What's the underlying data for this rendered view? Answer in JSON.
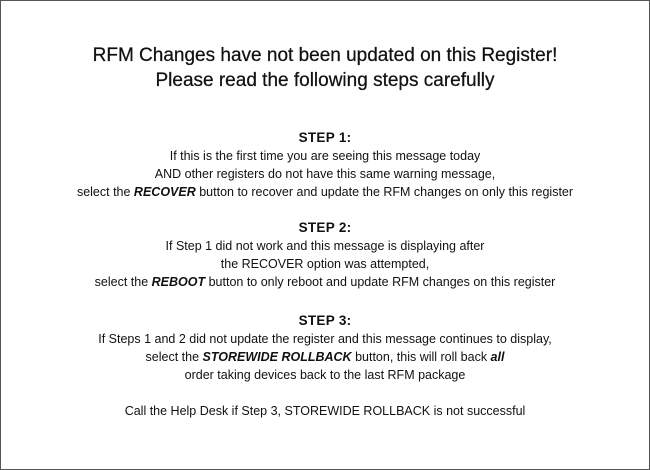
{
  "header": {
    "line1": "RFM Changes have not been updated on this Register!",
    "line2": "Please read the following steps carefully"
  },
  "step1": {
    "title": "STEP 1:",
    "line1": "If this is the first time you are seeing this message today",
    "line2": "AND other registers do not have this same warning message,",
    "line3_pre": "select the ",
    "line3_em": "RECOVER",
    "line3_post": " button to recover and update the RFM changes on only this register"
  },
  "step2": {
    "title": "STEP 2:",
    "line1": "If Step 1 did not work and this message is displaying after",
    "line2": "the RECOVER option was attempted,",
    "line3_pre": "select the ",
    "line3_em": "REBOOT",
    "line3_post": " button to only reboot and update RFM changes on this register"
  },
  "step3": {
    "title": "STEP 3:",
    "line1": "If Steps 1 and 2 did not update the register and this message continues to display,",
    "line2_pre": "select the ",
    "line2_em": "STOREWIDE ROLLBACK",
    "line2_mid": " button, this will roll back ",
    "line2_em2": "all",
    "line3": "order taking devices back to the last RFM package"
  },
  "footer": {
    "text": "Call the Help Desk if Step 3, STOREWIDE ROLLBACK is not successful"
  }
}
